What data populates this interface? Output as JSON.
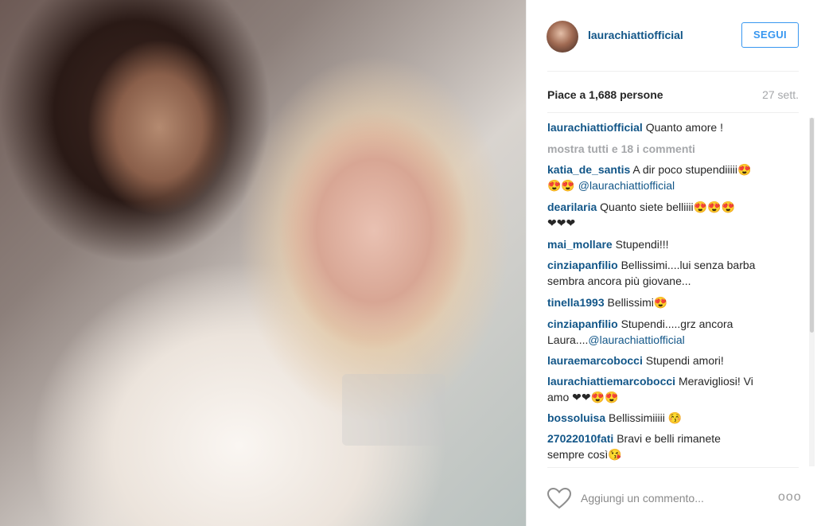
{
  "post": {
    "username": "laurachiattiofficial",
    "follow_label": "SEGUI",
    "likes": "Piace a 1,688 persone",
    "date": "27 sett.",
    "caption_user": "laurachiattiofficial",
    "caption_text": "Quanto amore !",
    "show_all": "mostra tutti e 18 i commenti"
  },
  "comments": [
    {
      "user": "katia_de_santis",
      "text": "A dir poco stupendiiiii😍",
      "line2": "😍😍",
      "mention": "@laurachiattiofficial"
    },
    {
      "user": "dearilaria",
      "text": "Quanto siete belliiii😍😍😍",
      "line2": "❤❤❤"
    },
    {
      "user": "mai_mollare",
      "text": "Stupendi!!!"
    },
    {
      "user": "cinziapanfilio",
      "text": "Bellissimi....lui senza barba",
      "line2": "sembra ancora più giovane..."
    },
    {
      "user": "tinella1993",
      "text": "Bellissimi😍"
    },
    {
      "user": "cinziapanfilio",
      "text": "Stupendi.....grz ancora",
      "line2": "Laura....",
      "mention": "@laurachiattiofficial"
    },
    {
      "user": "lauraemarcobocci",
      "text": "Stupendi amori!"
    },
    {
      "user": "laurachiattiemarcobocci",
      "text": "Meravigliosi! Vi",
      "line2": "amo ❤❤😍😍"
    },
    {
      "user": "bossoluisa",
      "text": "Bellissimiiiii 😚"
    },
    {
      "user": "27022010fati",
      "text": "Bravi e belli rimanete",
      "line2": "sempre così😘"
    }
  ],
  "footer": {
    "placeholder": "Aggiungi un commento...",
    "more": "ooo"
  },
  "icons": {
    "heart": "heart-outline-icon",
    "more": "more-options-icon"
  },
  "colors": {
    "link": "#125688",
    "button": "#3897f0"
  }
}
